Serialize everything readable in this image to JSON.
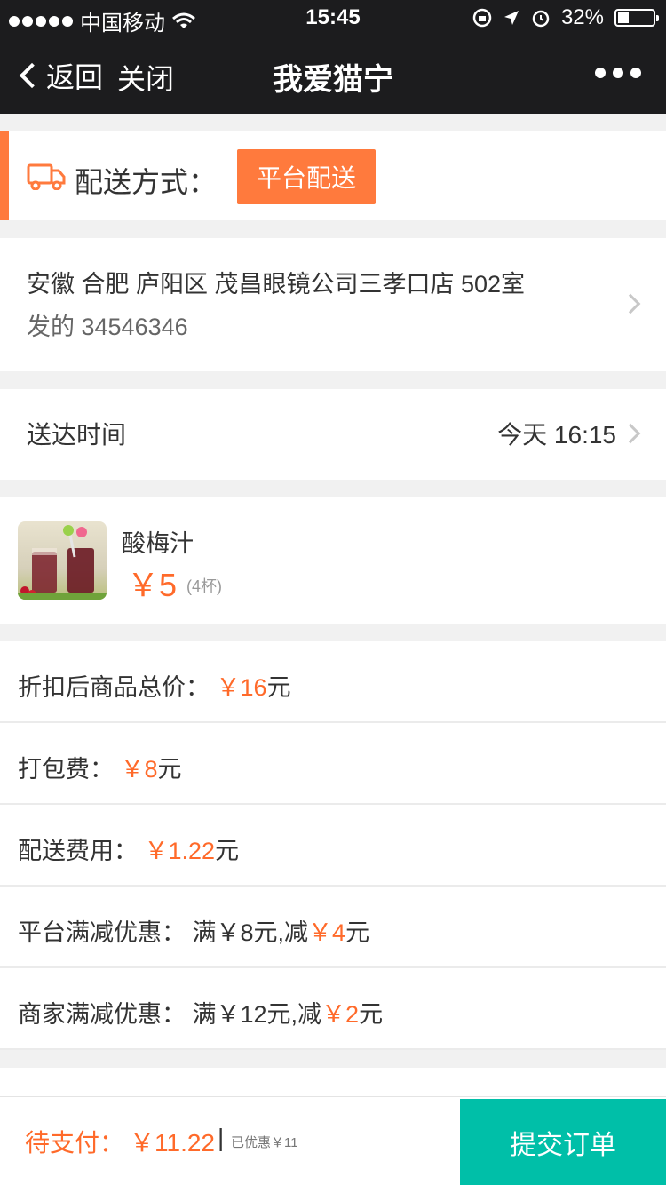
{
  "status_bar": {
    "carrier": "中国移动",
    "time": "15:45",
    "battery": "32%",
    "battery_level": 0.32
  },
  "nav": {
    "back_label": "返回",
    "close_label": "关闭",
    "title": "我爱猫宁"
  },
  "delivery": {
    "label": "配送方式：",
    "option": "平台配送"
  },
  "address": {
    "line1": "安徽 合肥 庐阳区 茂昌眼镜公司三孝口店 502室",
    "line2": "发的 34546346"
  },
  "delivery_time": {
    "label": "送达时间",
    "value": "今天 16:15"
  },
  "product": {
    "name": "酸梅汁",
    "price": "￥5",
    "qty": "(4杯)"
  },
  "fees": {
    "discounted_total_label": "折扣后商品总价：",
    "discounted_total_value": "￥16",
    "unit_yuan": "元",
    "packing_label": "打包费：",
    "packing_value": "￥8",
    "delivery_fee_label": "配送费用：",
    "delivery_fee_value": "￥1.22",
    "platform_discount_label": "平台满减优惠：",
    "platform_threshold": "满￥8元,减",
    "platform_off": "￥4",
    "merchant_discount_label": "商家满减优惠：",
    "merchant_threshold": "满￥12元,减",
    "merchant_off": "￥2"
  },
  "footer": {
    "pay_label": "待支付：",
    "pay_amount": "￥11.22",
    "separator": "|",
    "saved": "已优惠￥11",
    "submit_label": "提交订单"
  },
  "colors": {
    "accent_orange": "#ff7a3d",
    "price_orange": "#ff6a2a",
    "submit_teal": "#00bfa8",
    "nav_dark": "#1c1c1e"
  }
}
